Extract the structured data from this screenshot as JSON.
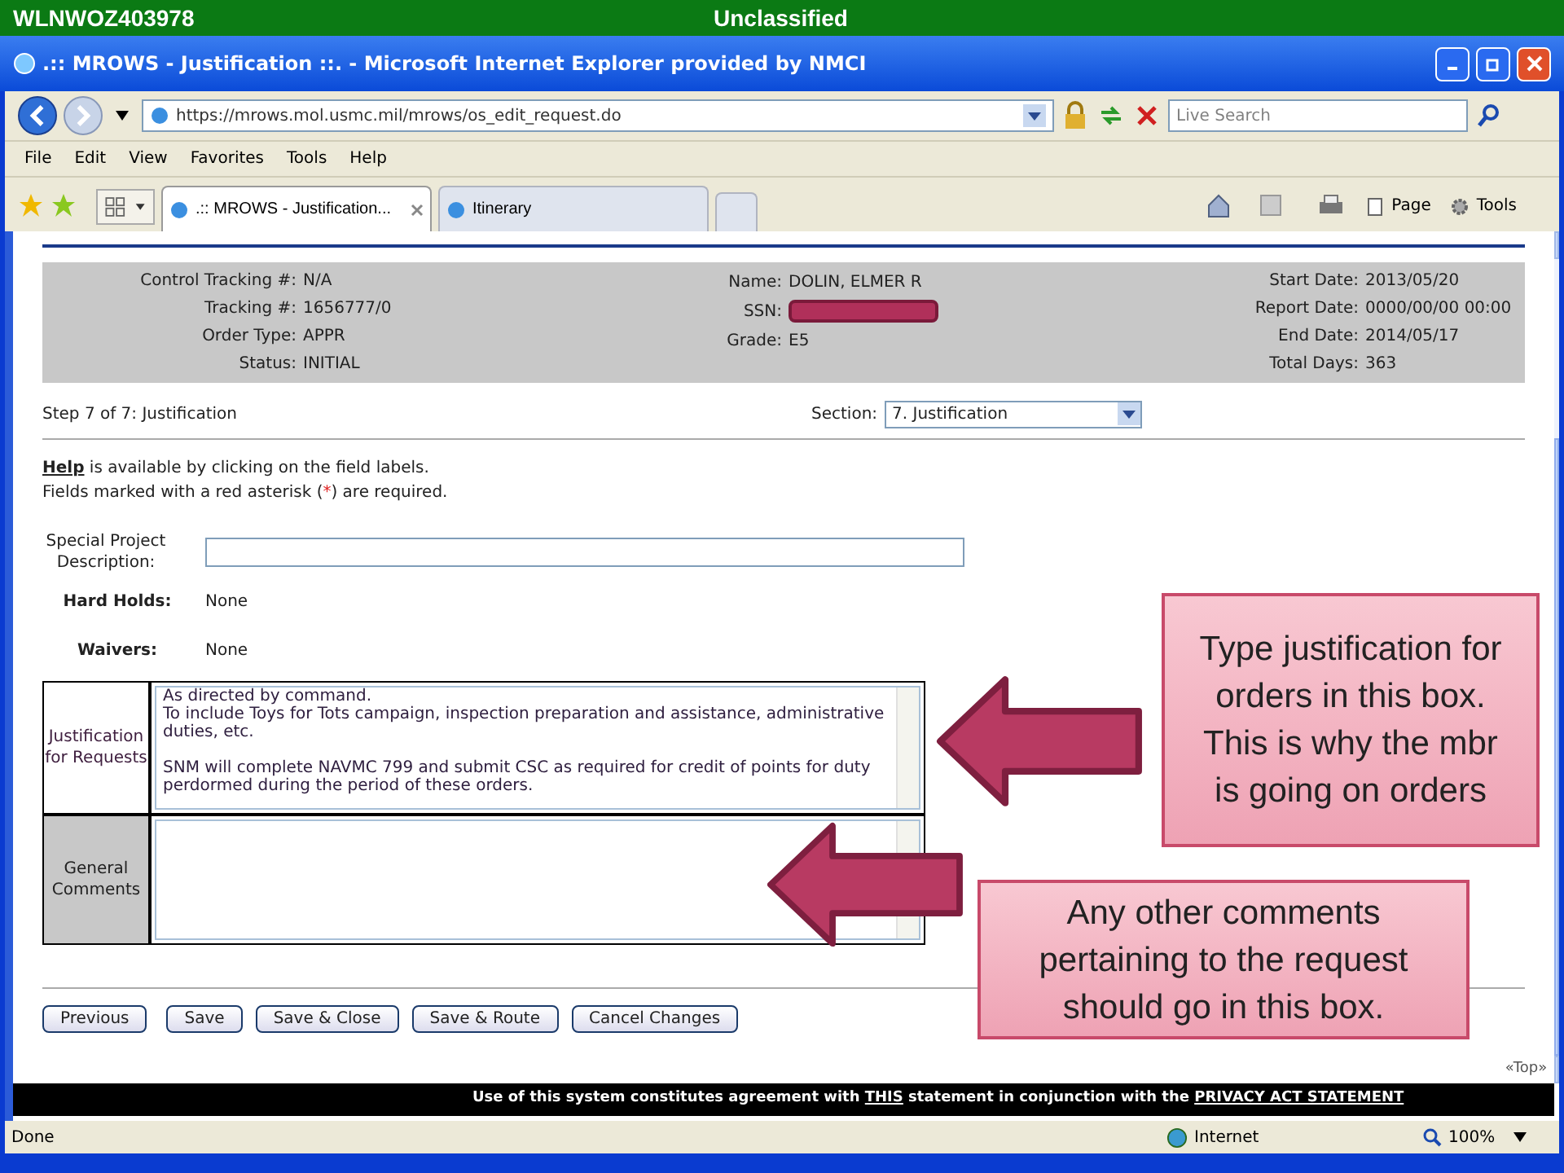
{
  "classification_bar": {
    "host": "WLNWOZ403978",
    "label": "Unclassified"
  },
  "window": {
    "title": ".:: MROWS - Justification ::. - Microsoft Internet Explorer provided by NMCI"
  },
  "address_bar": {
    "url": "https://mrows.mol.usmc.mil/mrows/os_edit_request.do",
    "search_placeholder": "Live Search"
  },
  "menu": [
    "File",
    "Edit",
    "View",
    "Favorites",
    "Tools",
    "Help"
  ],
  "tabs": [
    {
      "label": ".:: MROWS - Justification...",
      "selected": true
    },
    {
      "label": "Itinerary",
      "selected": false
    }
  ],
  "command_bar": [
    "Page",
    "Tools"
  ],
  "summary": [
    [
      {
        "label": "Control Tracking #:",
        "value": "N/A"
      },
      {
        "label": "Tracking #:",
        "value": "1656777/0"
      },
      {
        "label": "Order Type:",
        "value": "APPR"
      },
      {
        "label": "Status:",
        "value": "INITIAL"
      }
    ],
    [
      {
        "label": "Name:",
        "value": "DOLIN, ELMER R"
      },
      {
        "label": "SSN:",
        "redacted": true
      },
      {
        "label": "Grade:",
        "value": "E5"
      }
    ],
    [
      {
        "label": "Start Date:",
        "value": "2013/05/20"
      },
      {
        "label": "Report Date:",
        "value": "0000/00/00 00:00"
      },
      {
        "label": "End Date:",
        "value": "2014/05/17"
      },
      {
        "label": "Total Days:",
        "value": "363"
      }
    ]
  ],
  "step": "Step 7 of 7: Justification",
  "section": {
    "label": "Section:",
    "value": "7. Justification"
  },
  "help": {
    "link": "Help",
    "text": " is available by clicking on the field labels.",
    "note_before": "Fields marked with a red asterisk (",
    "asterisk": "*",
    "note_after": ") are required."
  },
  "special_project": {
    "label": "Special Project Description:"
  },
  "info_rows": [
    {
      "label": "Hard Holds:",
      "value": "None"
    },
    {
      "label": "Waivers:",
      "value": "None"
    }
  ],
  "text_areas": [
    {
      "label": "Justification for Requests",
      "value": "As directed by command.\nTo include Toys for Tots campaign, inspection preparation and assistance, administrative duties, etc.\n\nSNM will complete NAVMC 799 and submit CSC as required for credit of points for duty perdormed during the period of these orders."
    },
    {
      "label": "General Comments"
    }
  ],
  "buttons": [
    "Previous",
    "Save",
    "Save & Close",
    "Save & Route",
    "Cancel Changes"
  ],
  "top_link": "«Top»",
  "footer": {
    "before": "Use of this system constitutes agreement with ",
    "link1": "THIS",
    "middle": " statement in conjunction with the ",
    "link2": "PRIVACY ACT STATEMENT"
  },
  "status_bar": {
    "text": "Done",
    "zone": "Internet",
    "zoom": "100%"
  },
  "callouts": [
    "Type justification for orders in this box. This is why the mbr is going on orders",
    "Any other comments pertaining to the request should go in this box."
  ]
}
